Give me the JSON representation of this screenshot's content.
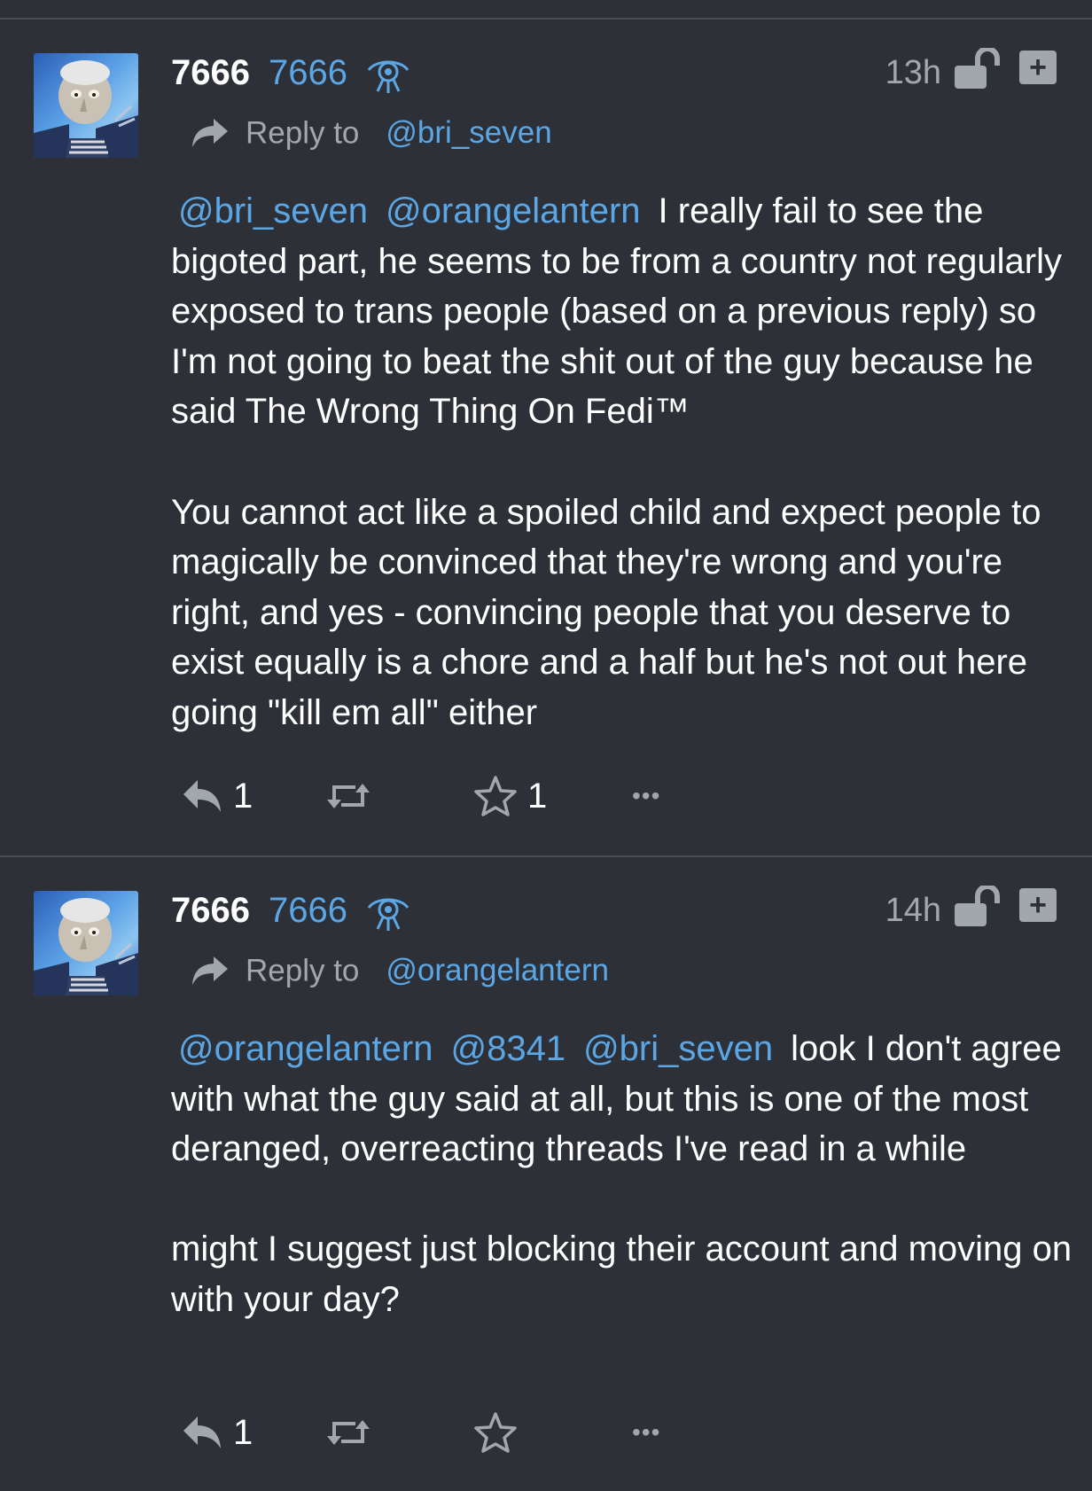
{
  "posts": [
    {
      "display_name": "7666",
      "handle": "7666",
      "time": "13h",
      "reply_to_label": "Reply to",
      "reply_to_handle": "@bri_seven",
      "mentions": [
        "@bri_seven",
        "@orangelantern"
      ],
      "paragraphs": [
        "I really fail to see the bigoted part, he seems to be from a country not regularly exposed to trans people (based on a previous reply) so I'm not going to beat the shit out of the guy because he said The Wrong Thing On Fedi™",
        "You cannot act like a spoiled child and expect people to magically be convinced that they're wrong and you're right, and yes - convincing people that you deserve to exist equally is a chore and a half but he's not out here going \"kill em all\" either"
      ],
      "reply_count": "1",
      "repeat_count": "",
      "favorite_count": "1",
      "more_label": "•••"
    },
    {
      "display_name": "7666",
      "handle": "7666",
      "time": "14h",
      "reply_to_label": "Reply to",
      "reply_to_handle": "@orangelantern",
      "mentions": [
        "@orangelantern",
        "@8341",
        "@bri_seven"
      ],
      "paragraphs": [
        "look I don't agree with what the guy said at all, but this is one of the most deranged, overreacting threads I've read in a while",
        "might I suggest just blocking their account and moving on with your day?"
      ],
      "reply_count": "1",
      "repeat_count": "",
      "favorite_count": "",
      "more_label": "•••"
    }
  ],
  "icons": {
    "badge": "eye-badge-icon",
    "lock": "unlocked-icon",
    "plus": "plus-icon",
    "reply_arrow": "share-arrow-icon",
    "reply": "reply-icon",
    "repeat": "repeat-icon",
    "favorite": "star-icon",
    "more": "more-icon"
  },
  "plus_label": "+",
  "colors": {
    "background": "#2e3038",
    "link": "#5ba7e6",
    "muted": "#a2a7ae",
    "text": "#ffffff"
  }
}
